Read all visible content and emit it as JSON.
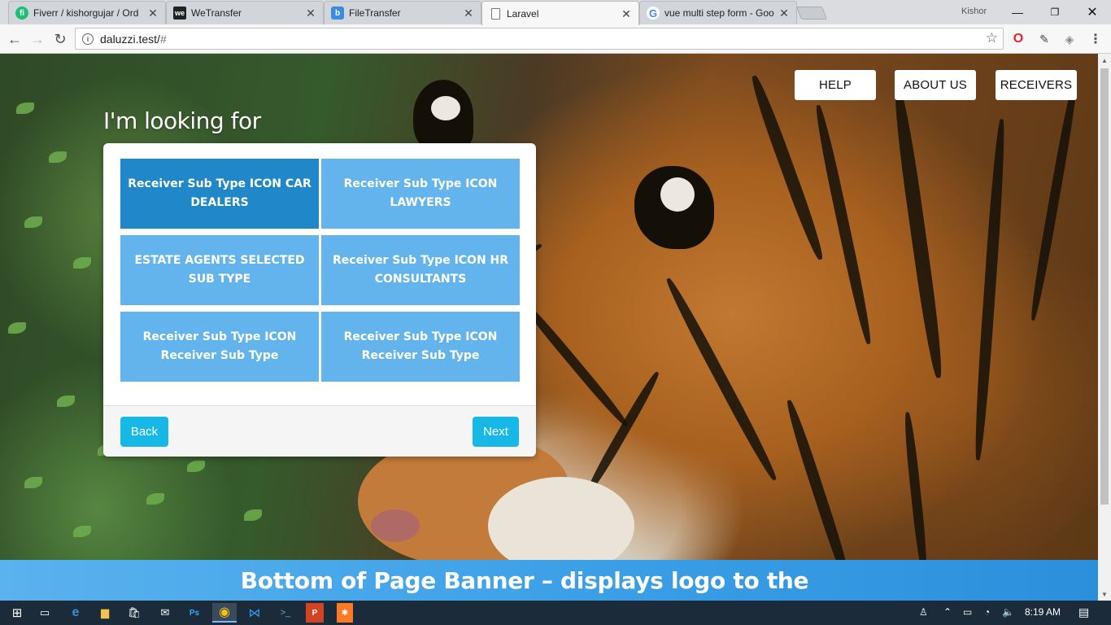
{
  "browser": {
    "tabs": [
      {
        "label": "Fiverr / kishorgujar / Ord",
        "icon": "fiverr-icon",
        "color": "#1dbf73",
        "glyph": "fi"
      },
      {
        "label": "WeTransfer",
        "icon": "wetransfer-icon",
        "color": "#222222",
        "glyph": "we"
      },
      {
        "label": "FileTransfer",
        "icon": "filetransfer-icon",
        "color": "#3a8dde",
        "glyph": "b"
      },
      {
        "label": "Laravel",
        "icon": "page-icon",
        "color": "#ffffff",
        "glyph": ""
      },
      {
        "label": "vue multi step form - Goo",
        "icon": "google-icon",
        "color": "#ffffff",
        "glyph": "G"
      }
    ],
    "active_tab_index": 3,
    "profile_name": "Kishor",
    "url": "daluzzi.test/",
    "url_hash": "#"
  },
  "page": {
    "nav": [
      "HELP",
      "ABOUT US",
      "RECEIVERS"
    ],
    "heading": "I'm looking for",
    "options": [
      "Receiver Sub Type ICON CAR DEALERS",
      "Receiver Sub Type ICON LAWYERS",
      "ESTATE AGENTS SELECTED SUB TYPE",
      "Receiver Sub Type ICON HR CONSULTANTS",
      "Receiver Sub Type ICON Receiver Sub Type",
      "Receiver Sub Type ICON Receiver Sub Type"
    ],
    "selected_option_index": 0,
    "back_label": "Back",
    "next_label": "Next",
    "banner_text": "Bottom of Page Banner – displays logo to the",
    "accent_color": "#17b8e6",
    "option_color": "#63b4ec",
    "selected_option_color": "#2088c8"
  },
  "taskbar": {
    "clock": "8:19 AM",
    "apps": [
      "windows-start-icon",
      "task-view-icon",
      "edge-icon",
      "file-explorer-icon",
      "store-icon",
      "mail-icon",
      "photoshop-icon",
      "chrome-icon",
      "vscode-icon",
      "powershell-icon",
      "powerpoint-icon",
      "xampp-icon"
    ]
  }
}
